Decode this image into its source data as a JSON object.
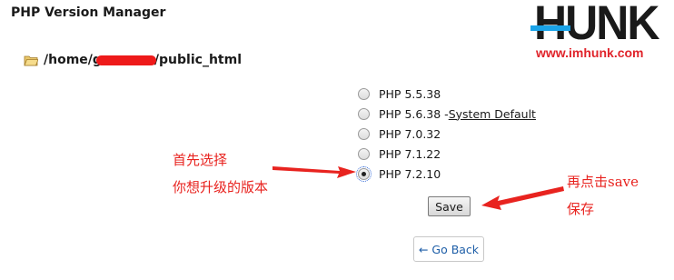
{
  "page": {
    "title": "PHP Version Manager"
  },
  "logo": {
    "brand": "HUNK",
    "url": "www.imhunk.com"
  },
  "directory": {
    "path_prefix": "/home/g",
    "path_suffix": "/public_html",
    "redacted": true
  },
  "versions": [
    {
      "label": "PHP 5.5.38",
      "suffix": "",
      "checked": false
    },
    {
      "label": "PHP 5.6.38 - ",
      "suffix": "System Default",
      "checked": false
    },
    {
      "label": "PHP 7.0.32",
      "suffix": "",
      "checked": false
    },
    {
      "label": "PHP 7.1.22",
      "suffix": "",
      "checked": false
    },
    {
      "label": "PHP 7.2.10",
      "suffix": "",
      "checked": true
    }
  ],
  "buttons": {
    "save_label": "Save",
    "goback_label": "← Go Back"
  },
  "annotations": {
    "left_line1": "首先选择",
    "left_line2": "你想升级的版本",
    "right_line1": "再点击save",
    "right_line2": "保存",
    "color": "#e8231f"
  }
}
